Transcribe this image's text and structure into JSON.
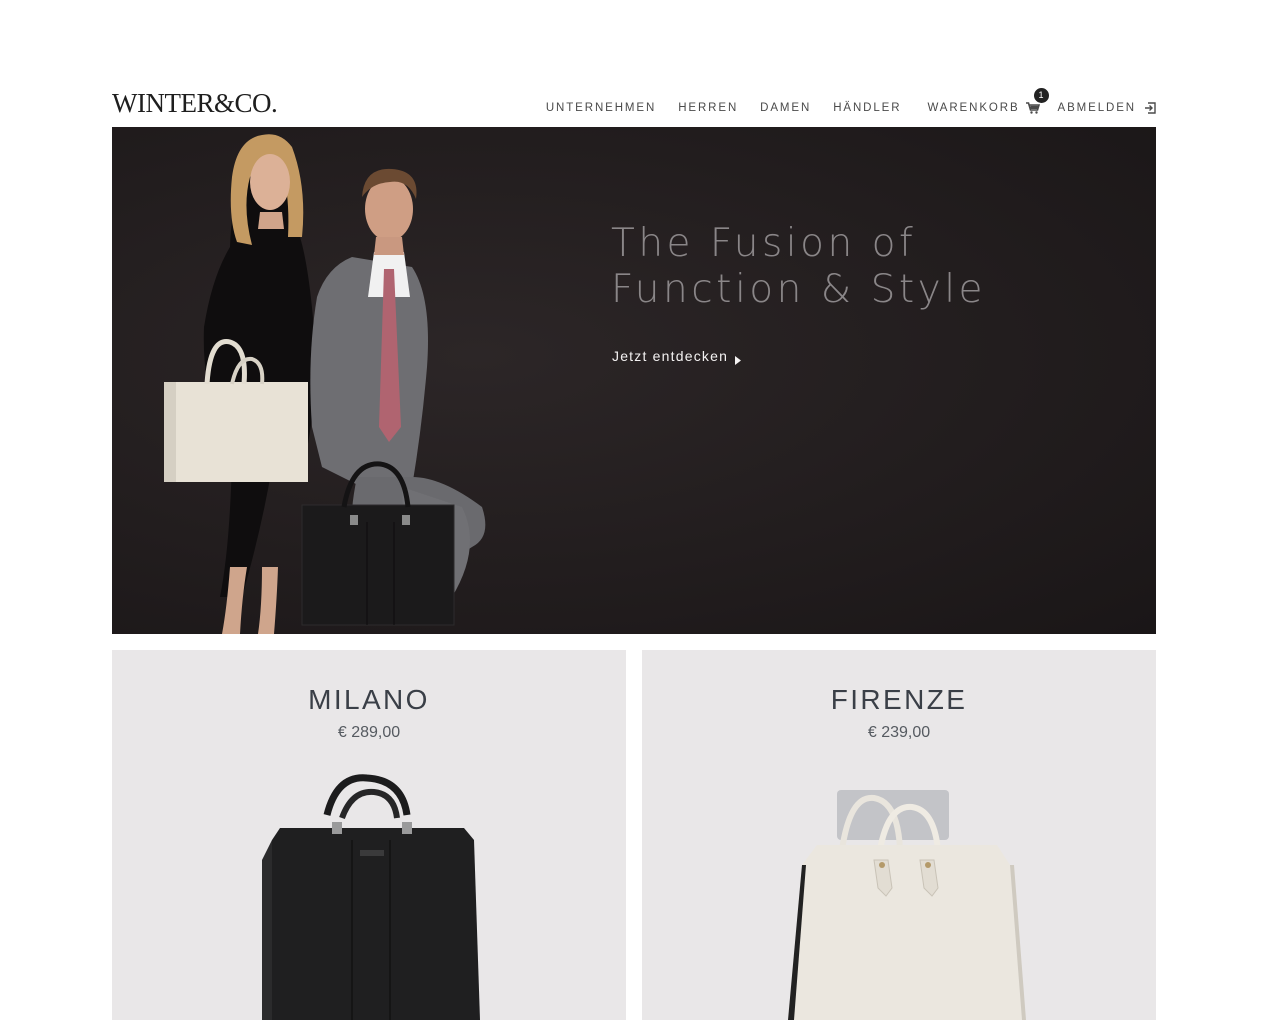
{
  "brand": {
    "logo_text": "WINTER&CO."
  },
  "nav": {
    "items": [
      {
        "label": "UNTERNEHMEN"
      },
      {
        "label": "HERREN"
      },
      {
        "label": "DAMEN"
      },
      {
        "label": "HÄNDLER"
      }
    ],
    "cart": {
      "label": "WARENKORB",
      "icon": "cart-icon",
      "count": "1"
    },
    "logout": {
      "label": "ABMELDEN",
      "icon": "logout-icon"
    }
  },
  "hero": {
    "title_line1": "The Fusion of",
    "title_line2": "Function & Style",
    "cta_label": "Jetzt entdecken",
    "cta_icon": "caret-right-icon"
  },
  "products": [
    {
      "name": "MILANO",
      "price": "€ 289,00",
      "color": "#1f1f20"
    },
    {
      "name": "FIRENZE",
      "price": "€ 239,00",
      "color": "#e6e2da"
    }
  ]
}
